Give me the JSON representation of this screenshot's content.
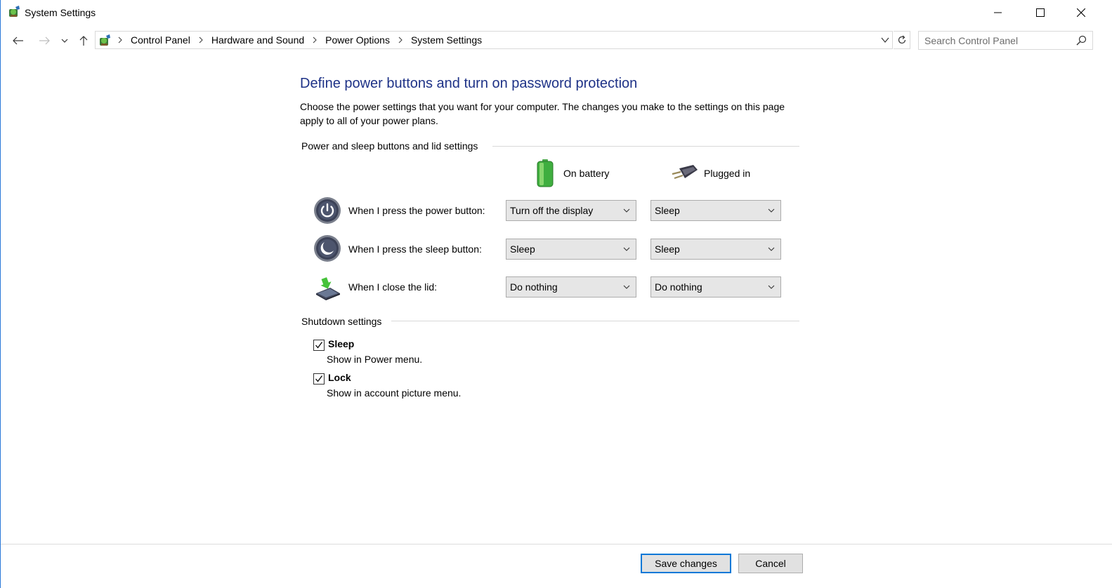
{
  "window": {
    "title": "System Settings",
    "icon": "control-panel-icon"
  },
  "nav": {
    "back": "back-arrow-icon",
    "forward": "forward-arrow-icon",
    "recent": "chevron-down-icon",
    "up": "up-arrow-icon"
  },
  "address": {
    "crumbs": [
      "Control Panel",
      "Hardware and Sound",
      "Power Options",
      "System Settings"
    ]
  },
  "search": {
    "placeholder": "Search Control Panel"
  },
  "page": {
    "heading": "Define power buttons and turn on password protection",
    "description": "Choose the power settings that you want for your computer. The changes you make to the settings on this page apply to all of your power plans."
  },
  "power_section": {
    "title": "Power and sleep buttons and lid settings",
    "columns": {
      "battery": "On battery",
      "plugged": "Plugged in"
    },
    "rows": [
      {
        "label": "When I press the power button:",
        "battery": "Turn off the display",
        "plugged": "Sleep",
        "icon": "power-button-icon"
      },
      {
        "label": "When I press the sleep button:",
        "battery": "Sleep",
        "plugged": "Sleep",
        "icon": "sleep-button-icon"
      },
      {
        "label": "When I close the lid:",
        "battery": "Do nothing",
        "plugged": "Do nothing",
        "icon": "laptop-lid-icon"
      }
    ]
  },
  "shutdown_section": {
    "title": "Shutdown settings",
    "items": [
      {
        "title": "Sleep",
        "subtitle": "Show in Power menu.",
        "checked": true
      },
      {
        "title": "Lock",
        "subtitle": "Show in account picture menu.",
        "checked": true
      }
    ]
  },
  "footer": {
    "save": "Save changes",
    "cancel": "Cancel"
  },
  "colors": {
    "heading": "#1e3287",
    "primary_border": "#0078d7",
    "button_bg": "#e1e1e1",
    "select_bg": "#e6e6e6"
  }
}
